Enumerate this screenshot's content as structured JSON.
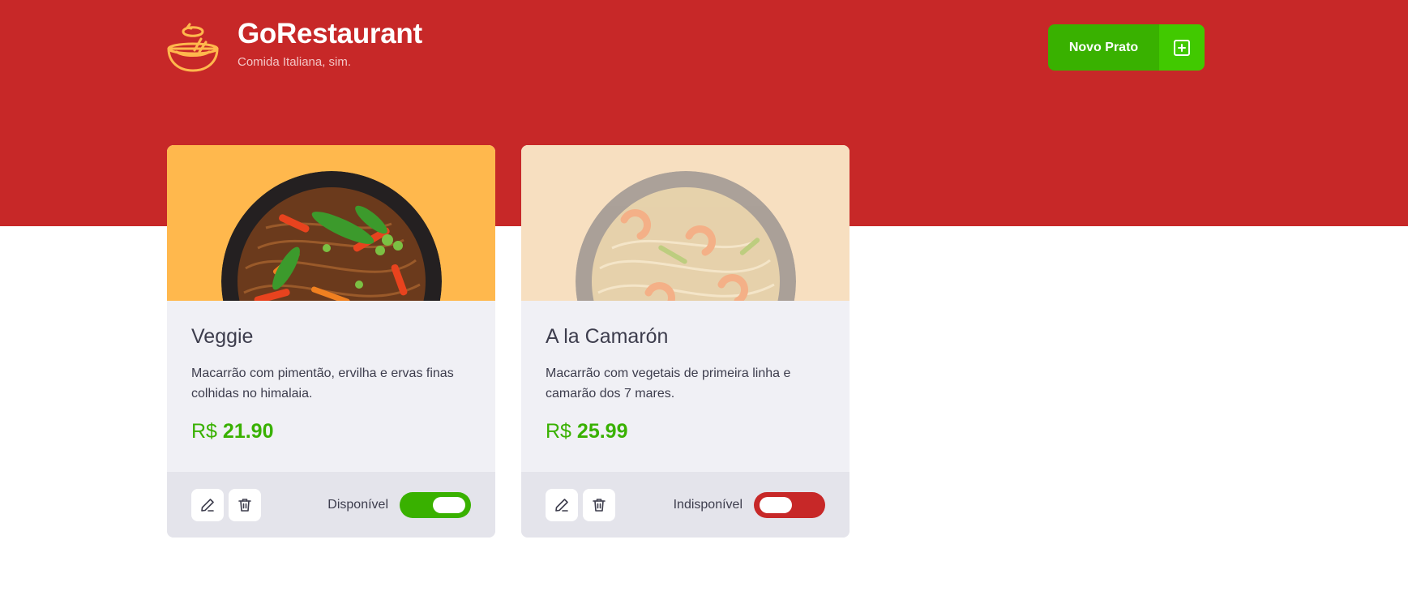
{
  "header": {
    "title": "GoRestaurant",
    "subtitle": "Comida Italiana, sim.",
    "logo_icon": "bowl-icon",
    "new_dish_button": {
      "label": "Novo Prato",
      "icon": "plus-square-icon"
    }
  },
  "colors": {
    "brand_red": "#c72828",
    "accent_green": "#39b100",
    "button_green_light": "#41c900",
    "card_background": "#f0f0f5",
    "card_footer": "#e4e4eb",
    "text_dark": "#3d3d4d"
  },
  "foods": [
    {
      "name": "Veggie",
      "description": "Macarrão com pimentão, ervilha e ervas finas colhidas no himalaia.",
      "currency": "R$",
      "price": "21.90",
      "availability_label": "Disponível",
      "available": true,
      "image_background": "#ffb84d",
      "edit_icon": "pencil-icon",
      "delete_icon": "trash-icon"
    },
    {
      "name": "A la Camarón",
      "description": "Macarrão com vegetais de primeira linha e camarão dos 7 mares.",
      "currency": "R$",
      "price": "25.99",
      "availability_label": "Indisponível",
      "available": false,
      "image_background": "#f7dfc0",
      "edit_icon": "pencil-icon",
      "delete_icon": "trash-icon"
    }
  ]
}
